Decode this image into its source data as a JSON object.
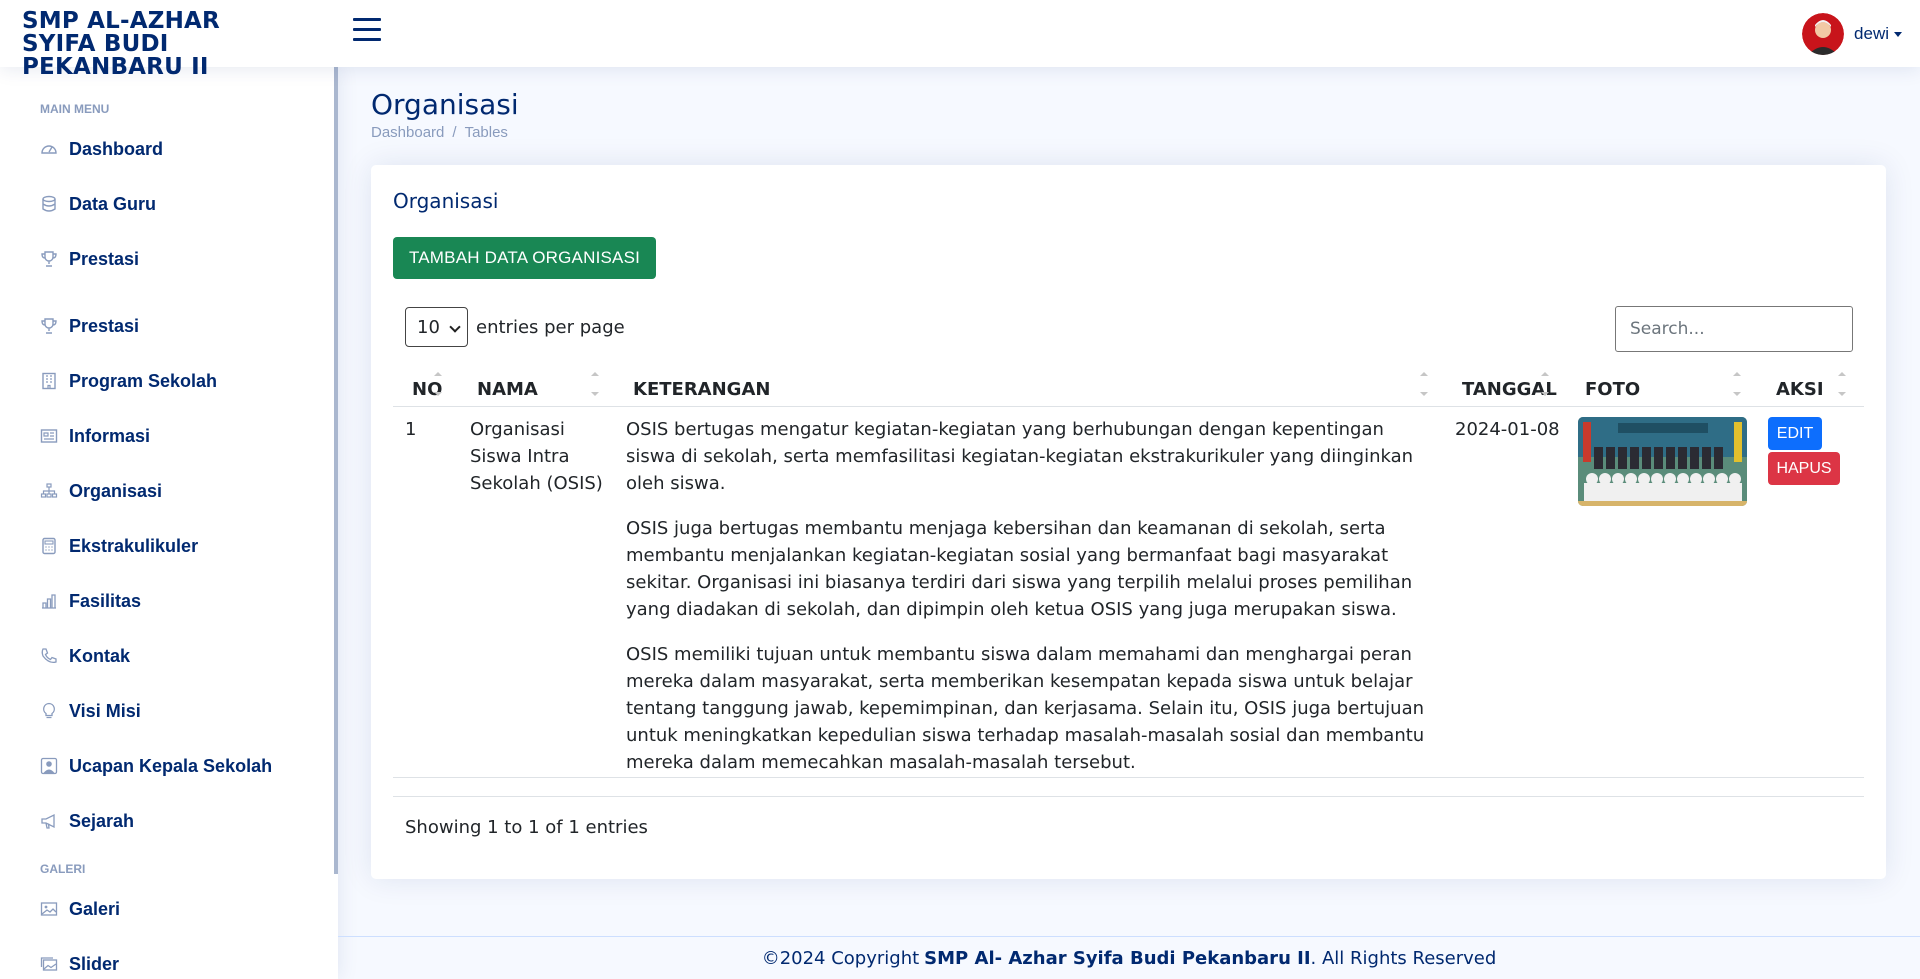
{
  "header": {
    "brand": "SMP AL-AZHAR SYIFA BUDI PEKANBARU II",
    "user_name": "dewi"
  },
  "sidebar": {
    "main_heading": "MAIN MENU",
    "items": [
      {
        "label": "Dashboard",
        "icon": "speedometer-icon"
      },
      {
        "label": "Data Guru",
        "icon": "database-icon"
      },
      {
        "label": "Prestasi",
        "icon": "trophy-icon"
      },
      {
        "label": "Prestasi",
        "icon": "trophy-icon"
      },
      {
        "label": "Program Sekolah",
        "icon": "building-icon"
      },
      {
        "label": "Informasi",
        "icon": "newspaper-icon"
      },
      {
        "label": "Organisasi",
        "icon": "diagram-icon"
      },
      {
        "label": "Ekstrakulikuler",
        "icon": "calculator-icon"
      },
      {
        "label": "Fasilitas",
        "icon": "bar-chart-icon"
      },
      {
        "label": "Kontak",
        "icon": "telephone-icon"
      },
      {
        "label": "Visi Misi",
        "icon": "lightbulb-icon"
      },
      {
        "label": "Ucapan Kepala Sekolah",
        "icon": "person-square-icon"
      },
      {
        "label": "Sejarah",
        "icon": "megaphone-icon"
      }
    ],
    "gallery_heading": "GALERI",
    "gallery_items": [
      {
        "label": "Galeri",
        "icon": "image-icon"
      },
      {
        "label": "Slider",
        "icon": "images-icon"
      }
    ]
  },
  "page": {
    "title": "Organisasi",
    "breadcrumb": [
      "Dashboard",
      "Tables"
    ],
    "card_title": "Organisasi",
    "add_button": "TAMBAH DATA ORGANISASI",
    "per_page_value": "10",
    "per_page_label": "entries per page",
    "search_placeholder": "Search...",
    "columns": [
      "NO",
      "NAMA",
      "KETERANGAN",
      "TANGGAL",
      "FOTO",
      "AKSI"
    ],
    "rows": [
      {
        "no": "1",
        "nama": "Organisasi Siswa Intra Sekolah (OSIS)",
        "keterangan": [
          "OSIS bertugas mengatur kegiatan-kegiatan yang berhubungan dengan kepentingan siswa di sekolah, serta memfasilitasi kegiatan-kegiatan ekstrakurikuler yang diinginkan oleh siswa.",
          "OSIS juga bertugas membantu menjaga kebersihan dan keamanan di sekolah, serta membantu menjalankan kegiatan-kegiatan sosial yang bermanfaat bagi masyarakat sekitar. Organisasi ini biasanya terdiri dari siswa yang terpilih melalui proses pemilihan yang diadakan di sekolah, dan dipimpin oleh ketua OSIS yang juga merupakan siswa.",
          "OSIS memiliki tujuan untuk membantu siswa dalam memahami dan menghargai peran mereka dalam masyarakat, serta memberikan kesempatan kepada siswa untuk belajar tentang tanggung jawab, kepemimpinan, dan kerjasama. Selain itu, OSIS juga bertujuan untuk meningkatkan kepedulian siswa terhadap masalah-masalah sosial dan membantu mereka dalam memecahkan masalah-masalah tersebut."
        ],
        "tanggal": "2024-01-08",
        "edit_label": "EDIT",
        "delete_label": "HAPUS"
      }
    ],
    "showing": "Showing 1 to 1 of 1 entries"
  },
  "footer": {
    "prefix": "©2024 Copyright",
    "org": "SMP Al- Azhar Syifa Budi Pekanbaru II",
    "suffix": ". All Rights Reserved"
  },
  "colors": {
    "brand": "#012970",
    "success": "#198754",
    "primary": "#0d6efd",
    "danger": "#dc3545"
  }
}
